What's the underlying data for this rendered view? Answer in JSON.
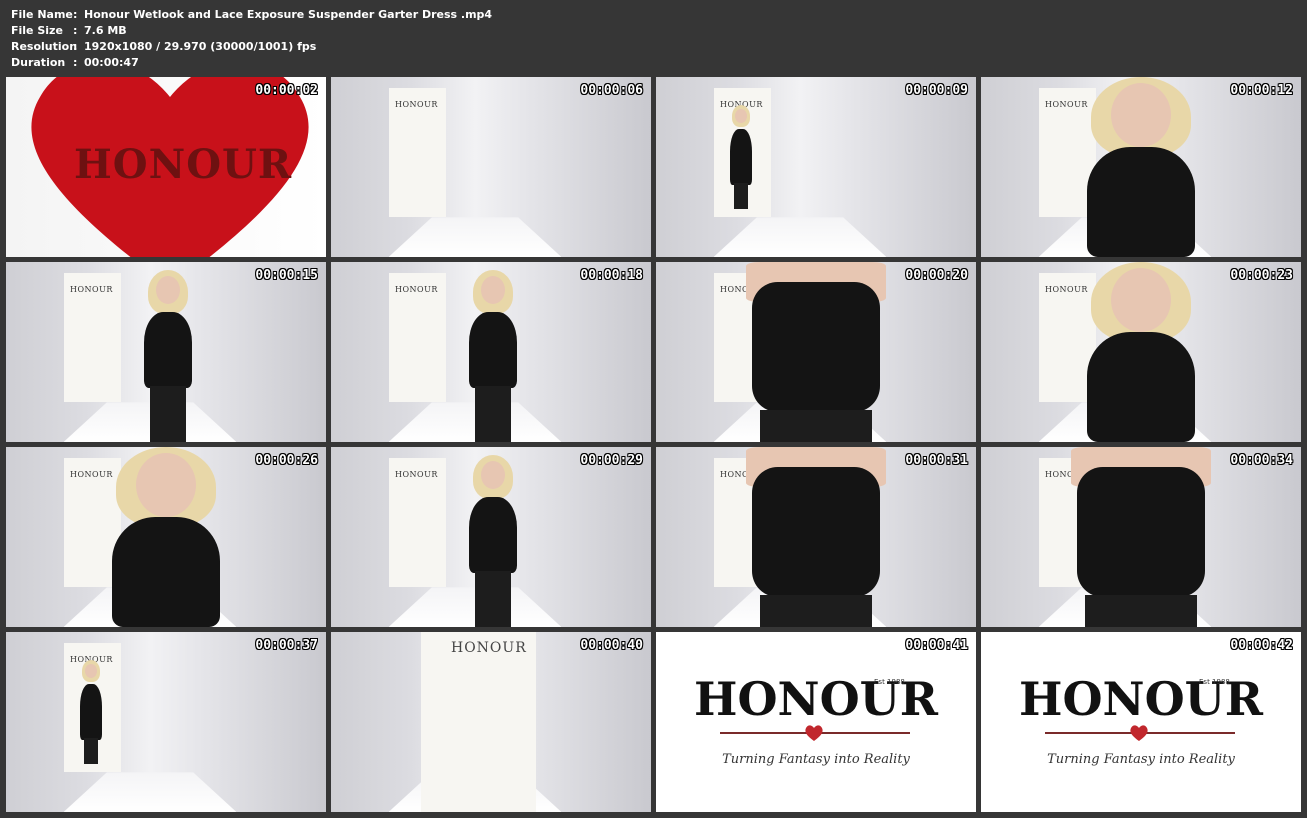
{
  "info": {
    "file_name_label": "File Name",
    "file_name": "Honour Wetlook and Lace Exposure Suspender Garter Dress .mp4",
    "file_size_label": "File Size",
    "file_size": "7.6 MB",
    "resolution_label": "Resolution",
    "resolution": "1920x1080 / 29.970 (30000/1001) fps",
    "duration_label": "Duration",
    "duration": "00:00:47",
    "separator": ":"
  },
  "thumbs": [
    {
      "time": "00:00:02",
      "scene": "heart"
    },
    {
      "time": "00:00:06",
      "scene": "empty"
    },
    {
      "time": "00:00:09",
      "scene": "far"
    },
    {
      "time": "00:00:12",
      "scene": "close"
    },
    {
      "time": "00:00:15",
      "scene": "mid"
    },
    {
      "time": "00:00:18",
      "scene": "mid"
    },
    {
      "time": "00:00:20",
      "scene": "back"
    },
    {
      "time": "00:00:23",
      "scene": "close"
    },
    {
      "time": "00:00:26",
      "scene": "close"
    },
    {
      "time": "00:00:29",
      "scene": "mid"
    },
    {
      "time": "00:00:31",
      "scene": "back"
    },
    {
      "time": "00:00:34",
      "scene": "back"
    },
    {
      "time": "00:00:37",
      "scene": "far"
    },
    {
      "time": "00:00:40",
      "scene": "empty-big"
    },
    {
      "time": "00:00:41",
      "scene": "brand"
    },
    {
      "time": "00:00:42",
      "scene": "brand"
    }
  ],
  "logo": {
    "word": "HONOUR",
    "small_word": "HONOUR",
    "est": "Est 1988",
    "tagline": "Turning Fantasy into Reality"
  },
  "colors": {
    "background": "#363636",
    "heart": "#c8111a",
    "brand_heart": "#c1272d"
  }
}
